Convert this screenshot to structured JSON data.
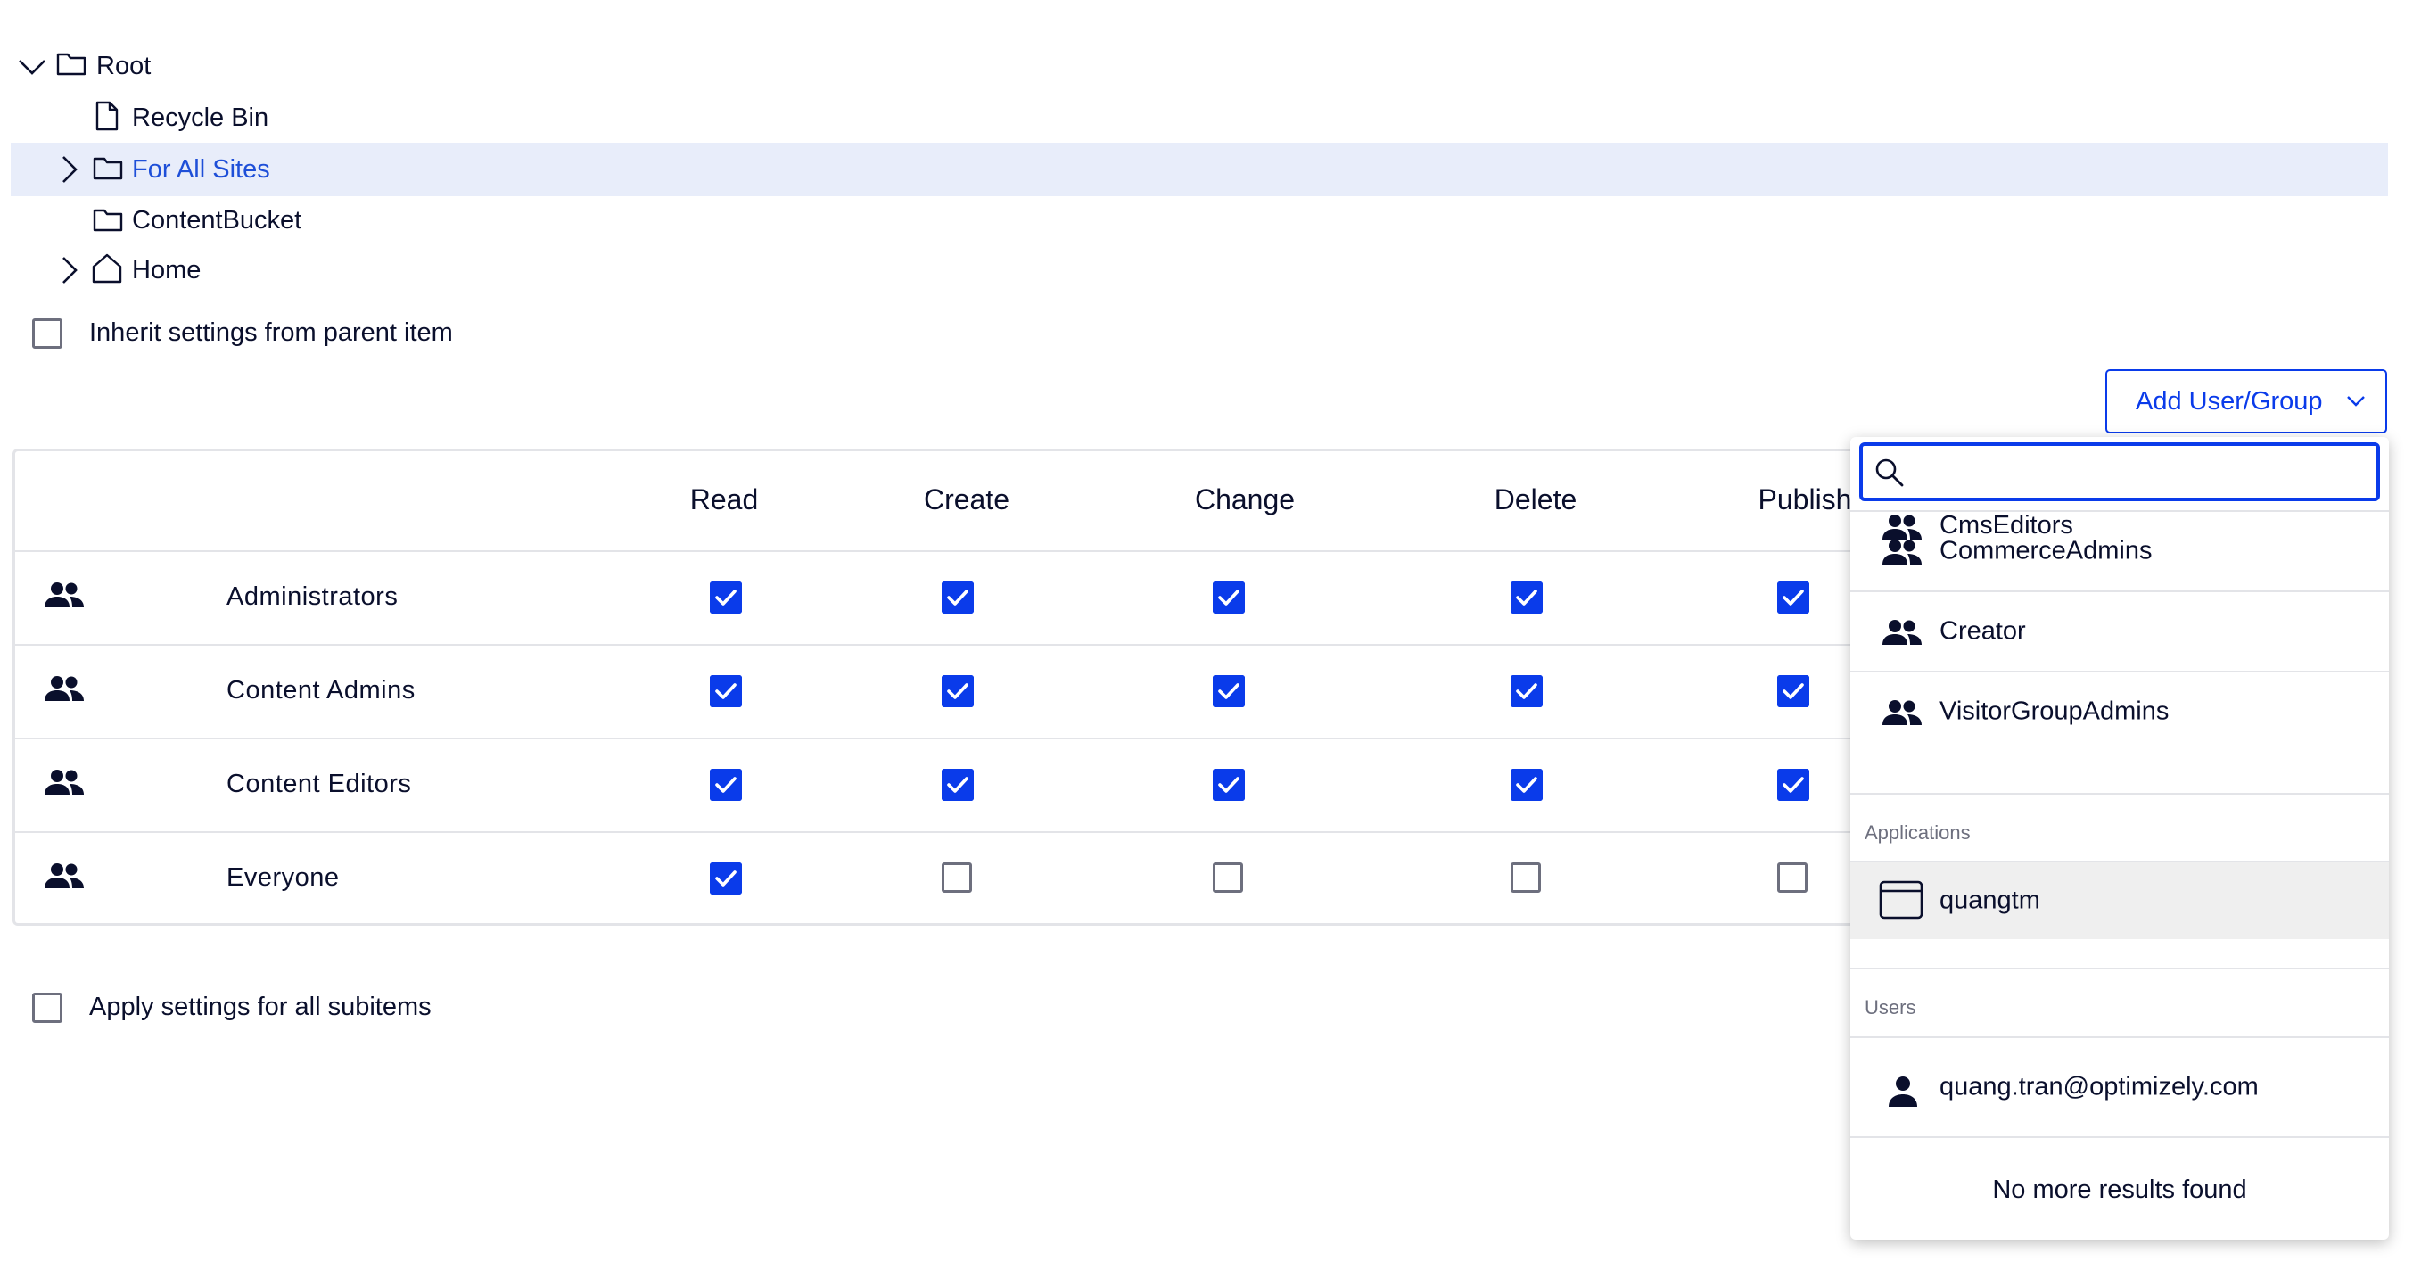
{
  "tree": {
    "items": [
      {
        "label": "Root",
        "icon": "folder-icon",
        "expander": "chevron-down-icon"
      },
      {
        "label": "Recycle Bin",
        "icon": "file-icon"
      },
      {
        "label": "For All Sites",
        "icon": "folder-icon",
        "expander": "chevron-right-icon",
        "selected": true
      },
      {
        "label": "ContentBucket",
        "icon": "folder-icon"
      },
      {
        "label": "Home",
        "icon": "home-icon",
        "expander": "chevron-right-icon"
      }
    ]
  },
  "inherit": {
    "label": "Inherit settings from parent item",
    "checked": false
  },
  "add_button": {
    "label": "Add User/Group"
  },
  "table": {
    "columns": [
      "Read",
      "Create",
      "Change",
      "Delete",
      "Publish"
    ],
    "rows": [
      {
        "name": "Administrators",
        "values": [
          true,
          true,
          true,
          true,
          true
        ]
      },
      {
        "name": "Content Admins",
        "values": [
          true,
          true,
          true,
          true,
          true
        ]
      },
      {
        "name": "Content Editors",
        "values": [
          true,
          true,
          true,
          true,
          true
        ]
      },
      {
        "name": "Everyone",
        "values": [
          true,
          false,
          false,
          false,
          false
        ]
      }
    ]
  },
  "apply_subitems": {
    "label": "Apply settings for all subitems",
    "checked": false
  },
  "dropdown": {
    "search": {
      "value": "",
      "placeholder": ""
    },
    "partial_item": "CmsEditors",
    "groups": [
      "CommerceAdmins",
      "Creator",
      "VisitorGroupAdmins"
    ],
    "applications_header": "Applications",
    "applications": [
      "quangtm"
    ],
    "users_header": "Users",
    "users": [
      "quang.tran@optimizely.com"
    ],
    "footer": "No more results found"
  },
  "colors": {
    "accent": "#0a3bea",
    "selected_bg": "#e8edfa",
    "text": "#0a0f2c"
  }
}
